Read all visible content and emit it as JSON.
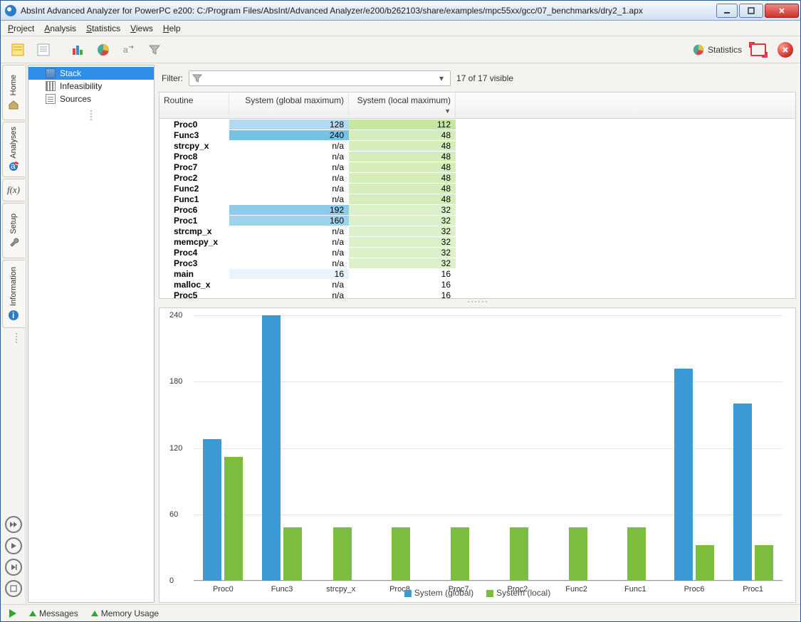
{
  "window": {
    "title": "AbsInt Advanced Analyzer for PowerPC e200: C:/Program Files/AbsInt/Advanced Analyzer/e200/b262103/share/examples/mpc55xx/gcc/07_benchmarks/dry2_1.apx"
  },
  "menu": {
    "project": "Project",
    "analysis": "Analysis",
    "statistics": "Statistics",
    "views": "Views",
    "help": "Help"
  },
  "toolbar": {
    "statistics": "Statistics"
  },
  "filter": {
    "label": "Filter:",
    "placeholder": "",
    "visible": "17 of 17 visible"
  },
  "sidebar": {
    "items": [
      {
        "label": "Stack"
      },
      {
        "label": "Infeasibility"
      },
      {
        "label": "Sources"
      }
    ]
  },
  "vtabs": {
    "home": "Home",
    "analyses": "Analyses",
    "fx": "f(x)",
    "setup": "Setup",
    "information": "Information"
  },
  "status": {
    "messages": "Messages",
    "memory": "Memory Usage"
  },
  "table": {
    "headers": {
      "routine": "Routine",
      "sys_global": "System (global maximum)",
      "sys_local": "System (local maximum)"
    },
    "rows": [
      {
        "routine": "Proc0",
        "g": "128",
        "l": "112",
        "gbg": "#b4d9ee",
        "lbg": "#c6e7a1"
      },
      {
        "routine": "Func3",
        "g": "240",
        "l": "48",
        "gbg": "#79c1e4",
        "lbg": "#d4edba"
      },
      {
        "routine": "strcpy_x",
        "g": "n/a",
        "l": "48",
        "gbg": "",
        "lbg": "#d4edba"
      },
      {
        "routine": "Proc8",
        "g": "n/a",
        "l": "48",
        "gbg": "",
        "lbg": "#d4edba"
      },
      {
        "routine": "Proc7",
        "g": "n/a",
        "l": "48",
        "gbg": "",
        "lbg": "#d4edba"
      },
      {
        "routine": "Proc2",
        "g": "n/a",
        "l": "48",
        "gbg": "",
        "lbg": "#d4edba"
      },
      {
        "routine": "Func2",
        "g": "n/a",
        "l": "48",
        "gbg": "",
        "lbg": "#d4edba"
      },
      {
        "routine": "Func1",
        "g": "n/a",
        "l": "48",
        "gbg": "",
        "lbg": "#d4edba"
      },
      {
        "routine": "Proc6",
        "g": "192",
        "l": "32",
        "gbg": "#8ccbe9",
        "lbg": "#dcf1c9"
      },
      {
        "routine": "Proc1",
        "g": "160",
        "l": "32",
        "gbg": "#9ed3ec",
        "lbg": "#dcf1c9"
      },
      {
        "routine": "strcmp_x",
        "g": "n/a",
        "l": "32",
        "gbg": "",
        "lbg": "#dcf1c9"
      },
      {
        "routine": "memcpy_x",
        "g": "n/a",
        "l": "32",
        "gbg": "",
        "lbg": "#dcf1c9"
      },
      {
        "routine": "Proc4",
        "g": "n/a",
        "l": "32",
        "gbg": "",
        "lbg": "#dcf1c9"
      },
      {
        "routine": "Proc3",
        "g": "n/a",
        "l": "32",
        "gbg": "",
        "lbg": "#dcf1c9"
      },
      {
        "routine": "main",
        "g": "16",
        "l": "16",
        "gbg": "#eaf5fb",
        "lbg": ""
      },
      {
        "routine": "malloc_x",
        "g": "n/a",
        "l": "16",
        "gbg": "",
        "lbg": ""
      },
      {
        "routine": "Proc5",
        "g": "n/a",
        "l": "16",
        "gbg": "",
        "lbg": ""
      }
    ]
  },
  "chart_data": {
    "type": "bar",
    "categories": [
      "Proc0",
      "Func3",
      "strcpy_x",
      "Proc8",
      "Proc7",
      "Proc2",
      "Func2",
      "Func1",
      "Proc6",
      "Proc1"
    ],
    "series": [
      {
        "name": "System (global)",
        "color": "#3b9ad6",
        "values": [
          128,
          240,
          null,
          null,
          null,
          null,
          null,
          null,
          192,
          160
        ]
      },
      {
        "name": "System (local)",
        "color": "#7bbd3e",
        "values": [
          112,
          48,
          48,
          48,
          48,
          48,
          48,
          48,
          32,
          32
        ]
      }
    ],
    "ylim": [
      0,
      240
    ],
    "yticks": [
      0,
      60,
      120,
      180,
      240
    ],
    "xlabel": "",
    "ylabel": ""
  }
}
